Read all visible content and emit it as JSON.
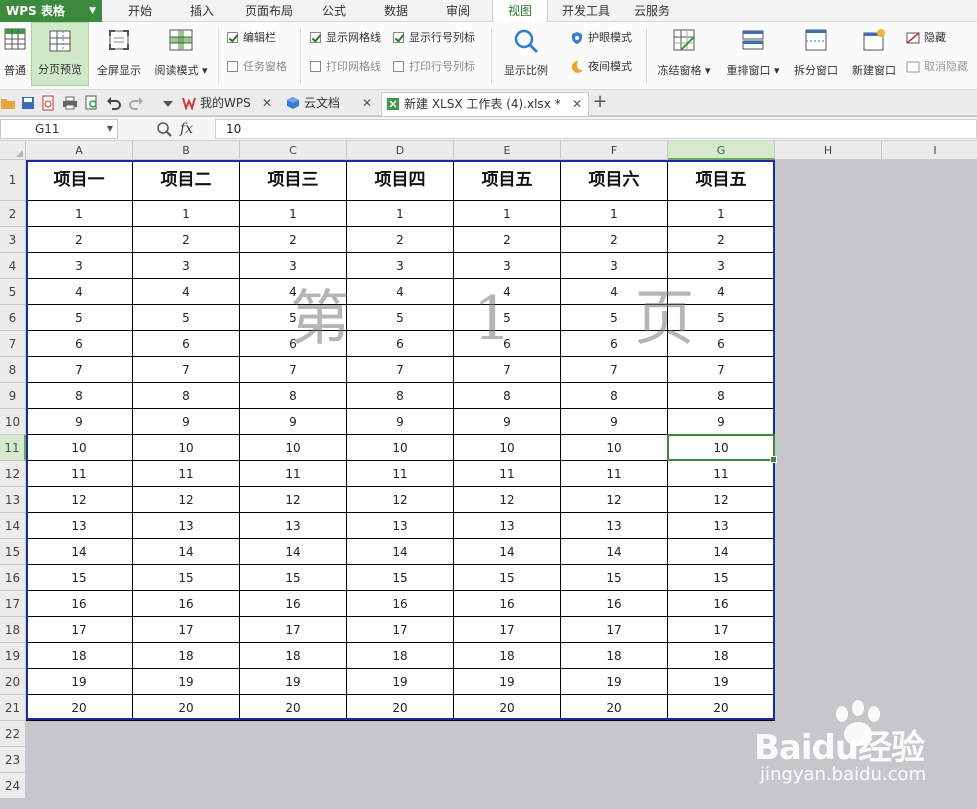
{
  "app": {
    "title": "WPS 表格"
  },
  "menu": [
    "开始",
    "插入",
    "页面布局",
    "公式",
    "数据",
    "审阅",
    "视图",
    "开发工具",
    "云服务"
  ],
  "menu_active": "视图",
  "ribbon": {
    "normal": "普通",
    "page_break_preview": "分页预览",
    "full_screen": "全屏显示",
    "reading_mode": "阅读模式",
    "edit_bar": "编辑栏",
    "task_pane": "任务窗格",
    "show_gridlines": "显示网格线",
    "print_gridlines": "打印网格线",
    "show_headings": "显示行号列标",
    "print_headings": "打印行号列标",
    "zoom": "显示比例",
    "eye_protection": "护眼模式",
    "night_mode": "夜间模式",
    "freeze_panes": "冻结窗格",
    "arrange_window": "重排窗口",
    "split_window": "拆分窗口",
    "new_window": "新建窗口",
    "hide": "隐藏",
    "unhide": "取消隐藏"
  },
  "tabs": [
    {
      "label": "我的WPS"
    },
    {
      "label": "云文档"
    },
    {
      "label": "新建 XLSX 工作表 (4).xlsx *"
    }
  ],
  "formula": {
    "cell_ref": "G11",
    "value": "10"
  },
  "grid": {
    "columns": [
      "A",
      "B",
      "C",
      "D",
      "E",
      "F",
      "G",
      "H",
      "I"
    ],
    "rows": [
      "1",
      "2",
      "3",
      "4",
      "5",
      "6",
      "7",
      "8",
      "9",
      "10",
      "11",
      "12",
      "13",
      "14",
      "15",
      "16",
      "17",
      "18",
      "19",
      "20",
      "21",
      "22",
      "23",
      "24"
    ],
    "selected_column": "G",
    "selected_row": "11",
    "headers": [
      "项目一",
      "项目二",
      "项目三",
      "项目四",
      "项目五",
      "项目六",
      "项目五"
    ],
    "values": [
      "1",
      "2",
      "3",
      "4",
      "5",
      "6",
      "7",
      "8",
      "9",
      "10",
      "11",
      "12",
      "13",
      "14",
      "15",
      "16",
      "17",
      "18",
      "19",
      "20"
    ]
  },
  "watermark": "第 1 页",
  "brand": {
    "name": "Baidu经验",
    "url": "jingyan.baidu.com"
  },
  "colors": {
    "accent": "#3b8a3e",
    "print_area_border": "#1c2a9a",
    "selection": "#3c8a36"
  }
}
